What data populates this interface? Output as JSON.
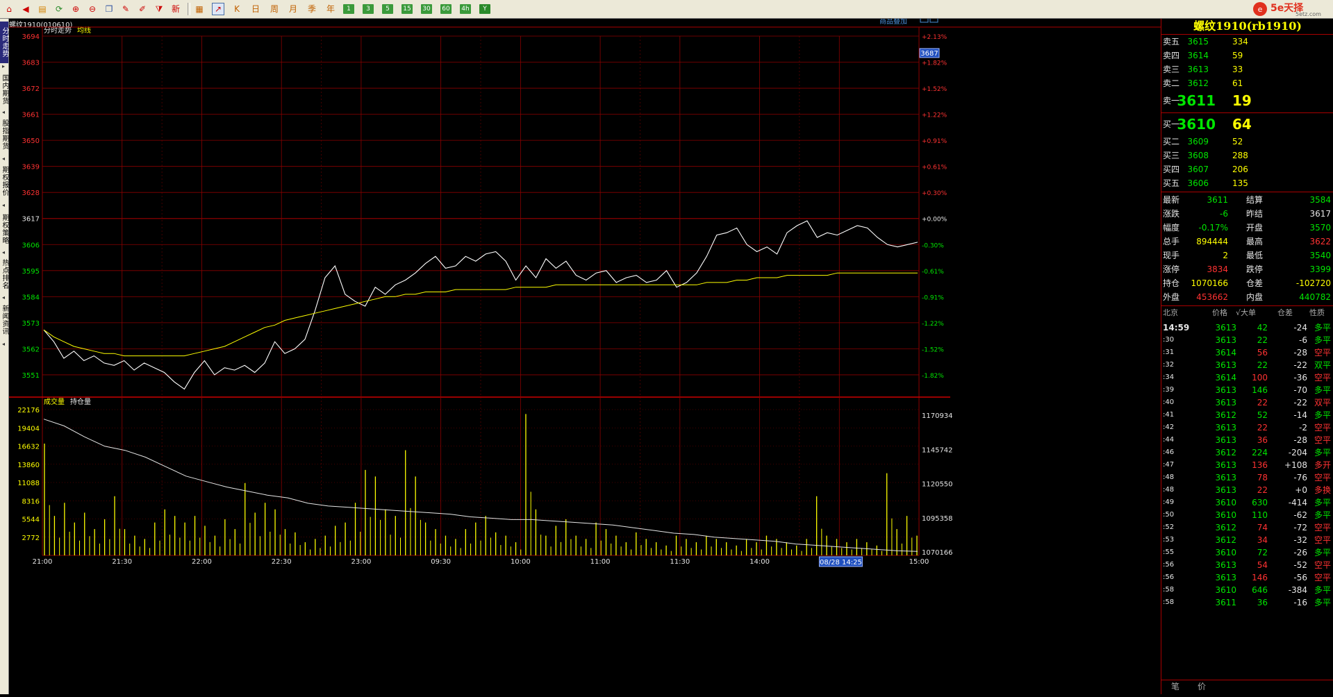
{
  "toolbar": {
    "buttons": [
      {
        "icon": "home-icon",
        "glyph": "⌂"
      },
      {
        "icon": "back-icon",
        "glyph": "◀"
      },
      {
        "icon": "book-icon",
        "glyph": "▤"
      },
      {
        "icon": "refresh-icon",
        "glyph": "⟳"
      },
      {
        "icon": "zoom-in-icon",
        "glyph": "⊕"
      },
      {
        "icon": "zoom-out-icon",
        "glyph": "⊖"
      },
      {
        "icon": "window-icon",
        "glyph": "❐"
      },
      {
        "icon": "pen-icon",
        "glyph": "✎"
      },
      {
        "icon": "brush-icon",
        "glyph": "✐"
      },
      {
        "icon": "filter-icon",
        "glyph": "⧩"
      },
      {
        "icon": "new-icon",
        "glyph": "新"
      }
    ],
    "buttons2": [
      {
        "icon": "table-icon",
        "glyph": "▦"
      },
      {
        "icon": "chart-line-icon",
        "glyph": "↗",
        "active": true
      },
      {
        "icon": "kline-icon",
        "glyph": "K"
      },
      {
        "icon": "day-icon",
        "glyph": "日"
      },
      {
        "icon": "week-icon",
        "glyph": "周"
      },
      {
        "icon": "month-icon",
        "glyph": "月"
      },
      {
        "icon": "season-icon",
        "glyph": "季"
      },
      {
        "icon": "year-icon",
        "glyph": "年"
      }
    ],
    "period_buttons": [
      "1",
      "3",
      "5",
      "15",
      "30",
      "60",
      "4h",
      "Y"
    ],
    "logo_text": "5e天择",
    "logo_sub": "5etz.com"
  },
  "sidebar": {
    "items": [
      {
        "label": "分时走势",
        "active": true
      },
      {
        "label": "国内期货",
        "active": false
      },
      {
        "label": "股指期货",
        "active": false
      },
      {
        "label": "期权报价",
        "active": false
      },
      {
        "label": "期权策略",
        "active": false
      },
      {
        "label": "热点排名",
        "active": false
      },
      {
        "label": "新闻资讯",
        "active": false
      }
    ]
  },
  "chart_header": {
    "instrument": "螺纹1910(010610)",
    "overlay_link": "商品叠加",
    "price_panel_tabs": [
      "分时走势",
      "均线"
    ],
    "volume_panel_tabs": [
      "成交量",
      "持仓量"
    ],
    "cursor_price_tag": "3687",
    "cursor_time_tag": "08/28 14:25"
  },
  "chart_data": [
    {
      "type": "line",
      "title": "分时走势",
      "y_left_ticks": [
        "3694",
        "3683",
        "3672",
        "3661",
        "3650",
        "3639",
        "3628",
        "3617",
        "3606",
        "3595",
        "3584",
        "3573",
        "3562",
        "3551"
      ],
      "y_right_ticks": [
        "+2.13%",
        "+1.82%",
        "+1.52%",
        "+1.22%",
        "+0.91%",
        "+0.61%",
        "+0.30%",
        "+0.00%",
        "-0.30%",
        "-0.61%",
        "-0.91%",
        "-1.22%",
        "-1.52%",
        "-1.82%"
      ],
      "ylim": [
        3546,
        3694
      ],
      "reference_price": 3617,
      "x_ticks": [
        "21:00",
        "21:30",
        "22:00",
        "22:30",
        "23:00",
        "09:30",
        "10:00",
        "11:00",
        "11:30",
        "14:00",
        "14:30",
        "15:00"
      ],
      "series": [
        {
          "name": "分时走势",
          "color": "#ffffff",
          "values": [
            3570,
            3565,
            3558,
            3561,
            3557,
            3559,
            3556,
            3555,
            3557,
            3553,
            3556,
            3554,
            3552,
            3548,
            3545,
            3552,
            3557,
            3551,
            3554,
            3553,
            3555,
            3552,
            3556,
            3565,
            3560,
            3562,
            3566,
            3578,
            3592,
            3597,
            3585,
            3582,
            3580,
            3588,
            3585,
            3589,
            3591,
            3594,
            3598,
            3601,
            3596,
            3597,
            3601,
            3599,
            3602,
            3603,
            3599,
            3591,
            3597,
            3592,
            3600,
            3596,
            3599,
            3593,
            3591,
            3594,
            3595,
            3590,
            3592,
            3593,
            3590,
            3591,
            3595,
            3588,
            3590,
            3594,
            3601,
            3610,
            3611,
            3613,
            3606,
            3603,
            3605,
            3602,
            3611,
            3614,
            3616,
            3609,
            3611,
            3610,
            3612,
            3614,
            3613,
            3609,
            3606,
            3605,
            3606,
            3607
          ]
        },
        {
          "name": "均线",
          "color": "#ffff00",
          "values": [
            3570,
            3567,
            3565,
            3563,
            3562,
            3561,
            3560,
            3560,
            3559,
            3559,
            3559,
            3559,
            3559,
            3559,
            3559,
            3560,
            3561,
            3562,
            3563,
            3565,
            3567,
            3569,
            3571,
            3572,
            3574,
            3575,
            3576,
            3577,
            3578,
            3579,
            3580,
            3581,
            3582,
            3583,
            3584,
            3584,
            3585,
            3585,
            3586,
            3586,
            3586,
            3587,
            3587,
            3587,
            3587,
            3587,
            3587,
            3588,
            3588,
            3588,
            3588,
            3589,
            3589,
            3589,
            3589,
            3589,
            3589,
            3589,
            3589,
            3589,
            3589,
            3589,
            3589,
            3589,
            3589,
            3589,
            3590,
            3590,
            3590,
            3591,
            3591,
            3592,
            3592,
            3592,
            3593,
            3593,
            3593,
            3593,
            3593,
            3594,
            3594,
            3594,
            3594,
            3594,
            3594,
            3594,
            3594,
            3594
          ]
        }
      ],
      "colors": {
        "axis_up": "#ff3232",
        "axis_down": "#ff3232",
        "grid": "#8b0000"
      }
    },
    {
      "type": "bar",
      "title": "成交量",
      "y_left_ticks": [
        "22176",
        "19404",
        "16632",
        "13860",
        "11088",
        "8316",
        "5544",
        "2772"
      ],
      "y_right_ticks": [
        "1170934",
        "1145742",
        "1120550",
        "1095358",
        "1070166"
      ],
      "ylim": [
        0,
        22176
      ],
      "open_interest_ylim": [
        1070166,
        1170934
      ],
      "x_ticks": [
        "21:00",
        "21:30",
        "22:00",
        "22:30",
        "23:00",
        "09:30",
        "10:00",
        "11:00",
        "11:30",
        "14:00",
        "14:30",
        "15:00"
      ],
      "series": [
        {
          "name": "成交量",
          "color": "#ffff00",
          "values": [
            17000,
            6000,
            8000,
            5000,
            6500,
            4000,
            5500,
            9000,
            4000,
            3000,
            2500,
            5000,
            7000,
            6000,
            5000,
            6000,
            4500,
            3000,
            5500,
            4000,
            11000,
            6500,
            8000,
            7000,
            4000,
            3500,
            2000,
            2500,
            3000,
            4500,
            5000,
            8000,
            13000,
            12000,
            7000,
            6000,
            16000,
            12000,
            5000,
            4000,
            3000,
            2500,
            4000,
            5000,
            6000,
            3500,
            3000,
            2000,
            21500,
            7000,
            3000,
            4500,
            5500,
            3000,
            2500,
            5000,
            4000,
            3000,
            2000,
            3500,
            2500,
            2000,
            1500,
            3000,
            2500,
            2000,
            3000,
            2500,
            2000,
            1500,
            2500,
            2000,
            3000,
            2500,
            2000,
            1500,
            2500,
            9000,
            3000,
            2500,
            2000,
            2500,
            2000,
            1500,
            12500,
            4000,
            6000,
            3000
          ]
        },
        {
          "name": "持仓量",
          "color": "#ffffff",
          "values": [
            1168000,
            1163000,
            1155000,
            1148000,
            1145000,
            1140000,
            1133000,
            1126000,
            1122000,
            1118000,
            1115000,
            1112000,
            1110000,
            1106000,
            1104000,
            1103000,
            1102000,
            1101000,
            1100000,
            1099000,
            1098000,
            1096000,
            1095000,
            1094000,
            1094000,
            1093000,
            1092000,
            1091000,
            1090000,
            1088000,
            1086000,
            1084000,
            1083000,
            1081000,
            1080000,
            1079000,
            1078000,
            1076000,
            1075000,
            1074000,
            1073000,
            1072000,
            1071000,
            1070500
          ]
        }
      ]
    }
  ],
  "quote": {
    "title": "螺纹1910(rb1910)",
    "asks": [
      {
        "label": "卖五",
        "price": "3615",
        "vol": "334"
      },
      {
        "label": "卖四",
        "price": "3614",
        "vol": "59"
      },
      {
        "label": "卖三",
        "price": "3613",
        "vol": "33"
      },
      {
        "label": "卖二",
        "price": "3612",
        "vol": "61"
      },
      {
        "label": "卖一",
        "price": "3611",
        "vol": "19"
      }
    ],
    "bids": [
      {
        "label": "买一",
        "price": "3610",
        "vol": "64"
      },
      {
        "label": "买二",
        "price": "3609",
        "vol": "52"
      },
      {
        "label": "买三",
        "price": "3608",
        "vol": "288"
      },
      {
        "label": "买四",
        "price": "3607",
        "vol": "206"
      },
      {
        "label": "买五",
        "price": "3606",
        "vol": "135"
      }
    ],
    "stats": [
      {
        "l1": "最新",
        "v1": "3611",
        "c1": "g",
        "l2": "结算",
        "v2": "3584",
        "c2": "g"
      },
      {
        "l1": "涨跌",
        "v1": "-6",
        "c1": "g",
        "l2": "昨结",
        "v2": "3617",
        "c2": "w"
      },
      {
        "l1": "幅度",
        "v1": "-0.17%",
        "c1": "g",
        "l2": "开盘",
        "v2": "3570",
        "c2": "g"
      },
      {
        "l1": "总手",
        "v1": "894444",
        "c1": "y",
        "l2": "最高",
        "v2": "3622",
        "c2": "r"
      },
      {
        "l1": "现手",
        "v1": "2",
        "c1": "y",
        "l2": "最低",
        "v2": "3540",
        "c2": "g"
      },
      {
        "l1": "涨停",
        "v1": "3834",
        "c1": "r",
        "l2": "跌停",
        "v2": "3399",
        "c2": "g"
      },
      {
        "l1": "持仓",
        "v1": "1070166",
        "c1": "y",
        "l2": "仓差",
        "v2": "-102720",
        "c2": "y"
      },
      {
        "l1": "外盘",
        "v1": "453662",
        "c1": "r",
        "l2": "内盘",
        "v2": "440782",
        "c2": "g"
      }
    ],
    "ticks_header": {
      "city": "北京",
      "price": "价格",
      "bigvol": "√大单",
      "oi": "仓差",
      "nature": "性质"
    },
    "ticks": [
      {
        "time": "14:59",
        "price": "3613",
        "vol": "42",
        "oi": "-24",
        "nature": "多平",
        "nc": "g"
      },
      {
        "time": ":30",
        "price": "3613",
        "vol": "22",
        "oi": "-6",
        "nature": "多平",
        "nc": "g"
      },
      {
        "time": ":31",
        "price": "3614",
        "vol": "56",
        "oi": "-28",
        "nature": "空平",
        "nc": "r"
      },
      {
        "time": ":32",
        "price": "3613",
        "vol": "22",
        "oi": "-22",
        "nature": "双平",
        "nc": "g"
      },
      {
        "time": ":34",
        "price": "3614",
        "vol": "100",
        "oi": "-36",
        "nature": "空平",
        "nc": "r"
      },
      {
        "time": ":39",
        "price": "3613",
        "vol": "146",
        "oi": "-70",
        "nature": "多平",
        "nc": "g"
      },
      {
        "time": ":40",
        "price": "3613",
        "vol": "22",
        "oi": "-22",
        "nature": "双平",
        "nc": "r"
      },
      {
        "time": ":41",
        "price": "3612",
        "vol": "52",
        "oi": "-14",
        "nature": "多平",
        "nc": "g"
      },
      {
        "time": ":42",
        "price": "3613",
        "vol": "22",
        "oi": "-2",
        "nature": "空平",
        "nc": "r"
      },
      {
        "time": ":44",
        "price": "3613",
        "vol": "36",
        "oi": "-28",
        "nature": "空平",
        "nc": "r"
      },
      {
        "time": ":46",
        "price": "3612",
        "vol": "224",
        "oi": "-204",
        "nature": "多平",
        "nc": "g"
      },
      {
        "time": ":47",
        "price": "3613",
        "vol": "136",
        "oi": "+108",
        "nature": "多开",
        "nc": "r"
      },
      {
        "time": ":48",
        "price": "3613",
        "vol": "78",
        "oi": "-76",
        "nature": "空平",
        "nc": "r"
      },
      {
        "time": ":48",
        "price": "3613",
        "vol": "22",
        "oi": "+0",
        "nature": "多换",
        "nc": "r"
      },
      {
        "time": ":49",
        "price": "3610",
        "vol": "630",
        "oi": "-414",
        "nature": "多平",
        "nc": "g"
      },
      {
        "time": ":50",
        "price": "3610",
        "vol": "110",
        "oi": "-62",
        "nature": "多平",
        "nc": "g"
      },
      {
        "time": ":52",
        "price": "3612",
        "vol": "74",
        "oi": "-72",
        "nature": "空平",
        "nc": "r"
      },
      {
        "time": ":53",
        "price": "3612",
        "vol": "34",
        "oi": "-32",
        "nature": "空平",
        "nc": "r"
      },
      {
        "time": ":55",
        "price": "3610",
        "vol": "72",
        "oi": "-26",
        "nature": "多平",
        "nc": "g"
      },
      {
        "time": ":56",
        "price": "3613",
        "vol": "54",
        "oi": "-52",
        "nature": "空平",
        "nc": "r"
      },
      {
        "time": ":56",
        "price": "3613",
        "vol": "146",
        "oi": "-56",
        "nature": "空平",
        "nc": "r"
      },
      {
        "time": ":58",
        "price": "3610",
        "vol": "646",
        "oi": "-384",
        "nature": "多平",
        "nc": "g"
      },
      {
        "time": ":58",
        "price": "3611",
        "vol": "36",
        "oi": "-16",
        "nature": "多平",
        "nc": "g"
      }
    ],
    "bottom_tabs": [
      "笔",
      "价"
    ]
  }
}
